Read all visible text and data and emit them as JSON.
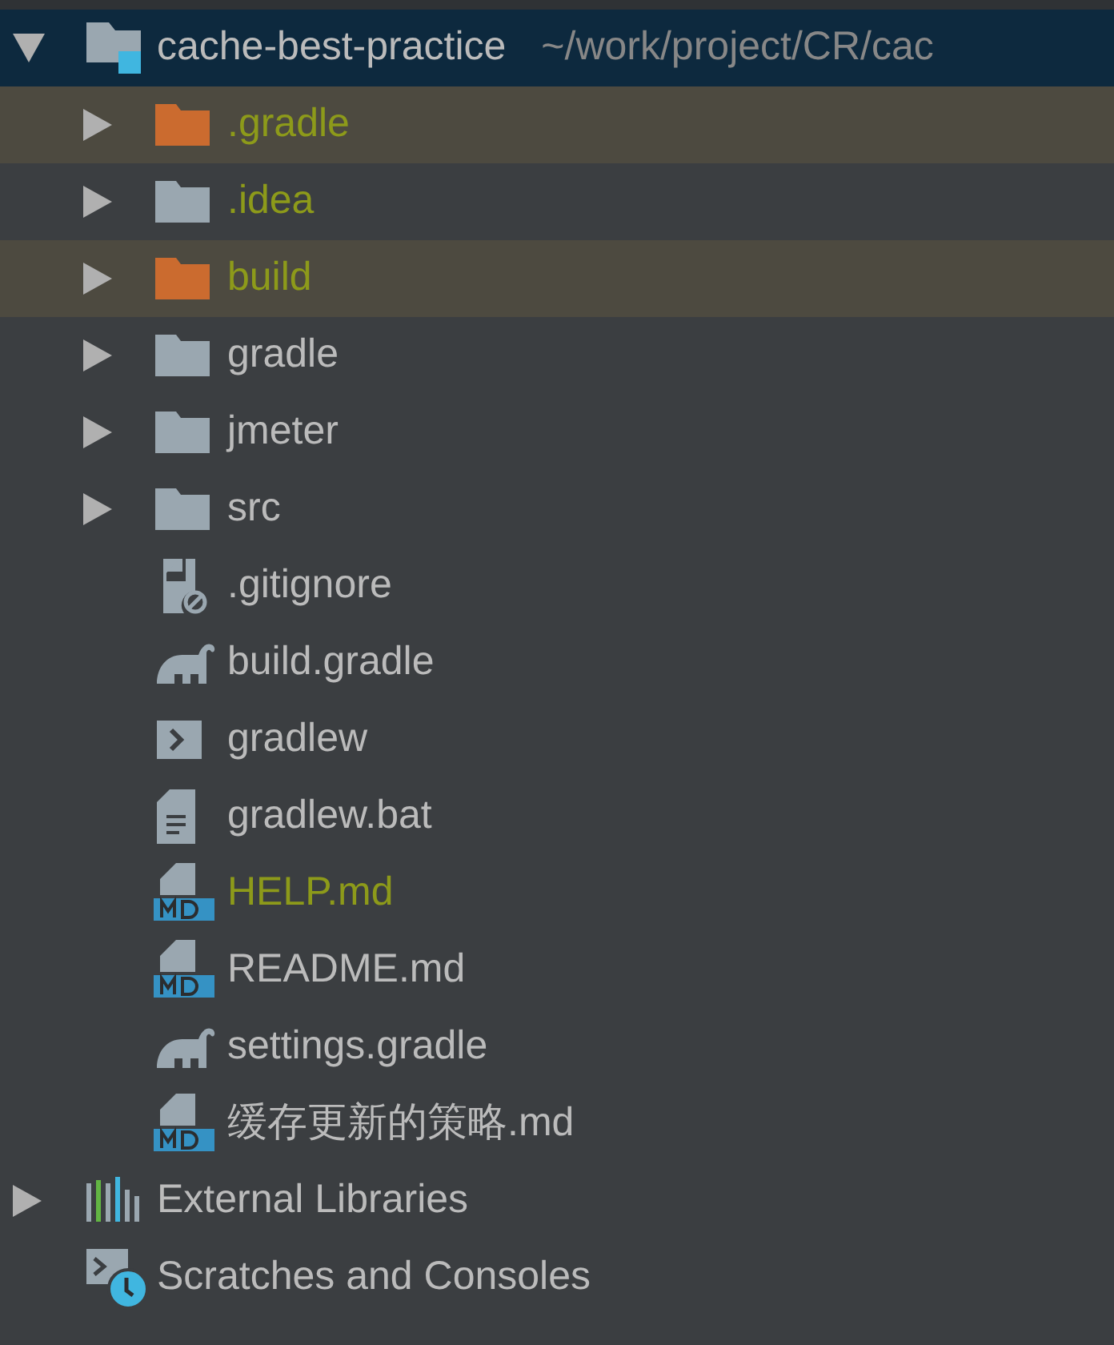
{
  "project_tree": [
    {
      "label": "cache-best-practice",
      "path": "~/work/project/CR/cac",
      "kind": "module",
      "expanded": true,
      "selected": true,
      "ignored": false,
      "children": [
        {
          "label": ".gradle",
          "kind": "folder",
          "expanded": false,
          "selected": false,
          "excluded": true,
          "ignored": true
        },
        {
          "label": ".idea",
          "kind": "folder",
          "expanded": false,
          "selected": false,
          "excluded": false,
          "ignored": true
        },
        {
          "label": "build",
          "kind": "folder",
          "expanded": false,
          "selected": false,
          "excluded": true,
          "ignored": true
        },
        {
          "label": "gradle",
          "kind": "folder",
          "expanded": false,
          "selected": false,
          "excluded": false,
          "ignored": false
        },
        {
          "label": "jmeter",
          "kind": "folder",
          "expanded": false,
          "selected": false,
          "excluded": false,
          "ignored": false
        },
        {
          "label": "src",
          "kind": "folder",
          "expanded": false,
          "selected": false,
          "excluded": false,
          "ignored": false
        },
        {
          "label": ".gitignore",
          "kind": "blocked",
          "selected": false,
          "excluded": false,
          "ignored": false
        },
        {
          "label": "build.gradle",
          "kind": "elephant",
          "selected": false,
          "excluded": false,
          "ignored": false
        },
        {
          "label": "gradlew",
          "kind": "terminal",
          "selected": false,
          "excluded": false,
          "ignored": false
        },
        {
          "label": "gradlew.bat",
          "kind": "text",
          "selected": false,
          "excluded": false,
          "ignored": false
        },
        {
          "label": "HELP.md",
          "kind": "markdown",
          "selected": false,
          "excluded": false,
          "ignored": true
        },
        {
          "label": "README.md",
          "kind": "markdown",
          "selected": false,
          "excluded": false,
          "ignored": false
        },
        {
          "label": "settings.gradle",
          "kind": "elephant",
          "selected": false,
          "excluded": false,
          "ignored": false
        },
        {
          "label": "缓存更新的策略.md",
          "kind": "markdown",
          "selected": false,
          "excluded": false,
          "ignored": false
        }
      ]
    },
    {
      "label": "External Libraries",
      "kind": "libraries",
      "expanded": false,
      "selected": false,
      "excluded": false,
      "ignored": false
    },
    {
      "label": "Scratches and Consoles",
      "kind": "scratches",
      "selected": false,
      "excluded": false,
      "ignored": false
    }
  ]
}
